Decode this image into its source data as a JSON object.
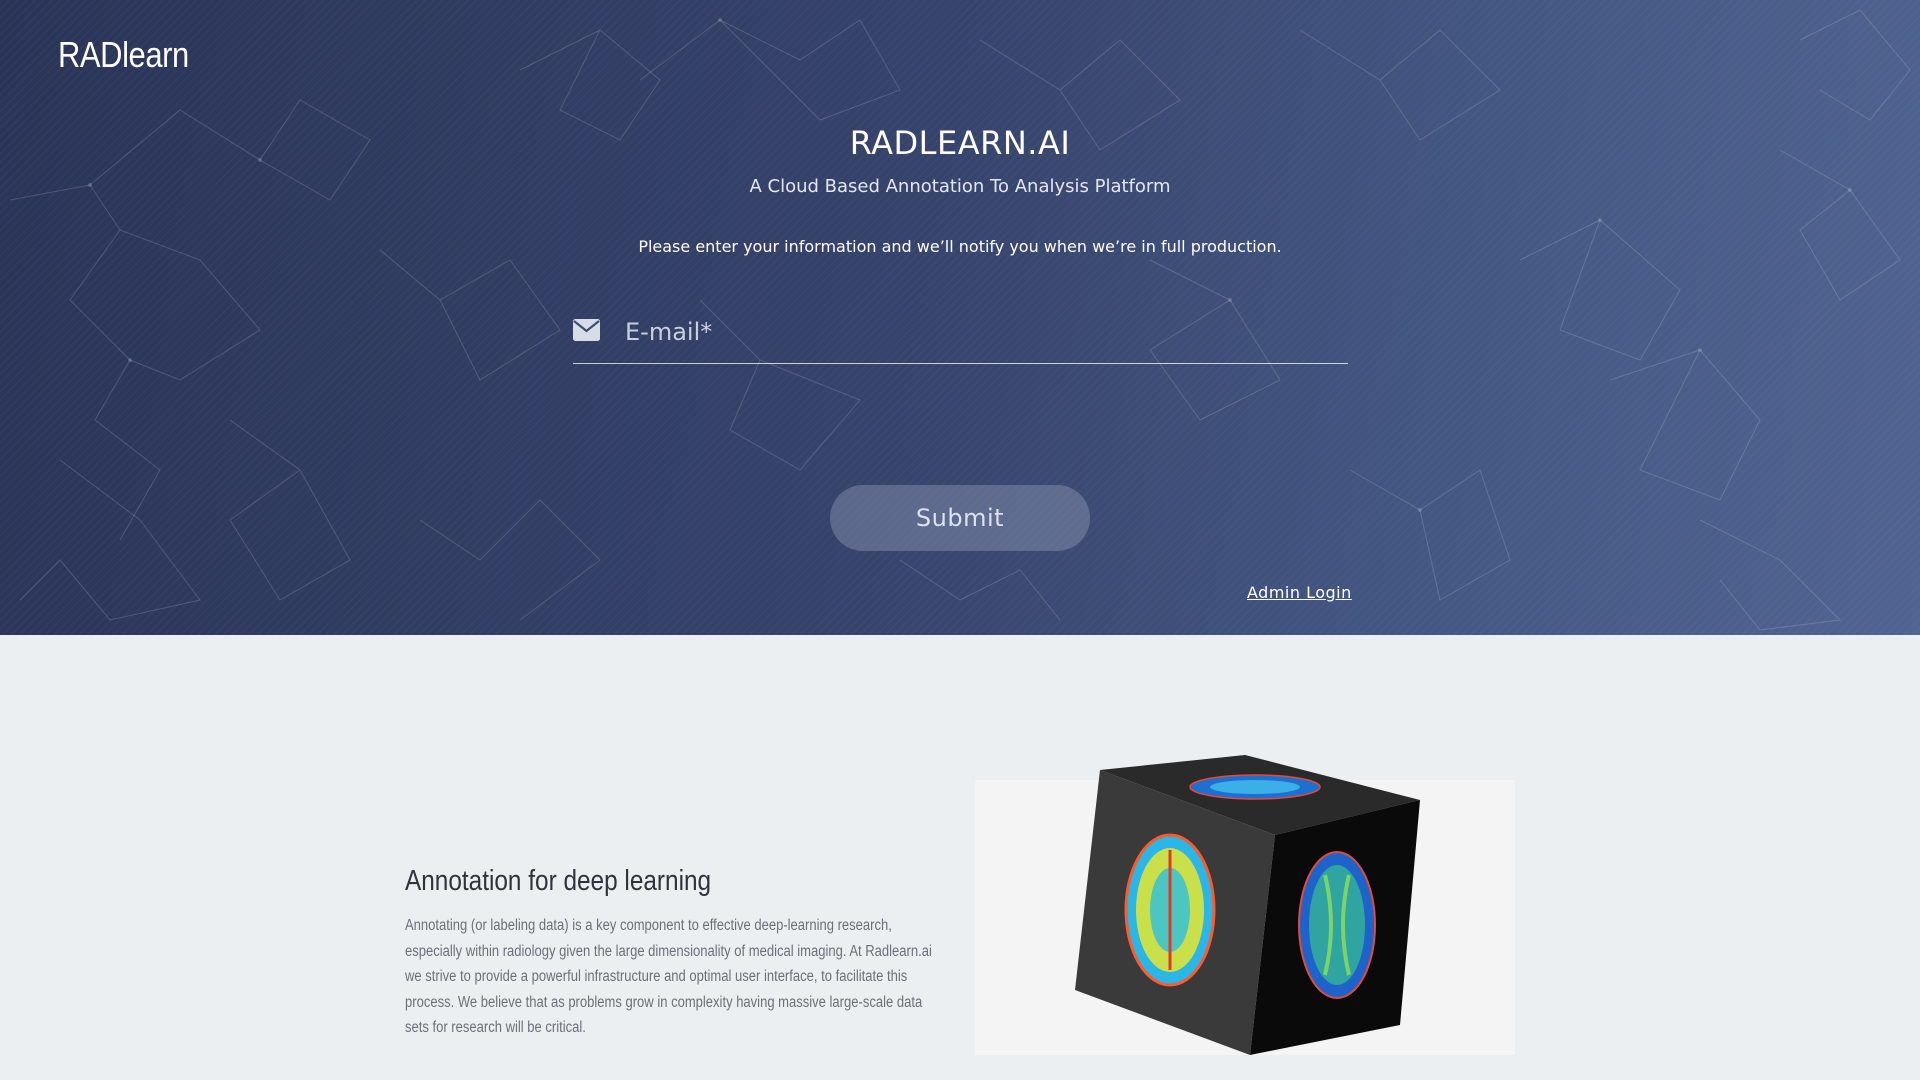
{
  "header": {
    "brand": "RADlearn"
  },
  "hero": {
    "title": "RADLEARN.AI",
    "subtitle": "A Cloud Based Annotation To Analysis Platform",
    "notice": "Please enter your information and we’ll notify you when we’re in full production."
  },
  "form": {
    "email_icon": "envelope-icon",
    "email_placeholder": "E-mail*",
    "email_value": "",
    "submit_label": "Submit",
    "admin_link": "Admin Login"
  },
  "feature": {
    "title": "Annotation for deep learning",
    "body": "Annotating (or labeling data) is a key component to effective deep-learning research, especially within radiology given the large dimensionality of medical imaging. At Radlearn.ai we strive to provide a powerful infrastructure and optimal user interface, to facilitate this process. We believe that as problems grow in complexity having massive large-scale data sets for research will be critical.",
    "image_icon": "brain-mri-cube-image"
  },
  "colors": {
    "hero_start": "#2a3457",
    "hero_end": "#4f6490",
    "page_bg": "#eceff2",
    "heading_text": "#2f333c",
    "body_text": "#6b6f78"
  }
}
